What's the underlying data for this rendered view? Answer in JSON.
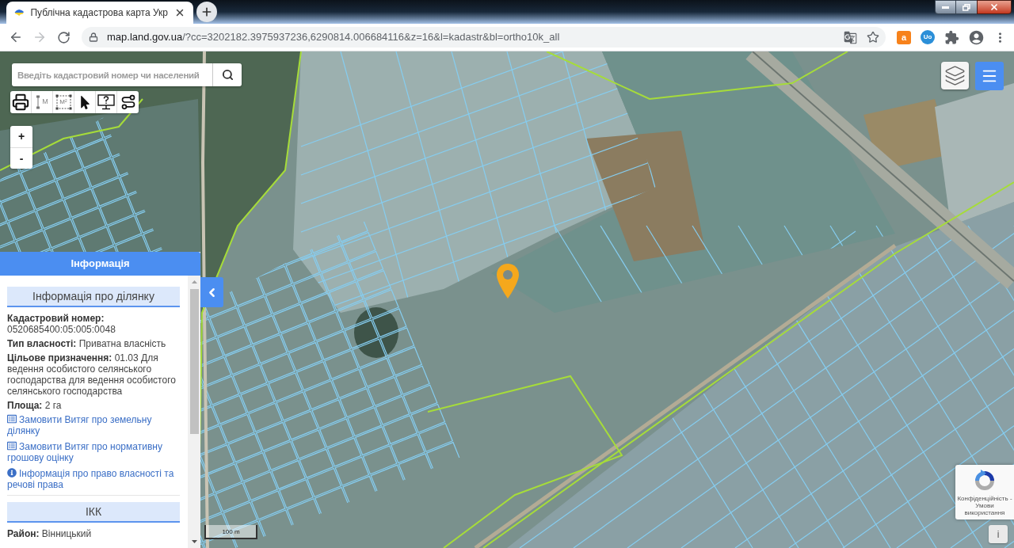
{
  "browser": {
    "tabs": [
      {
        "title": "Публічна кадастрова карта Укр",
        "selected": true
      }
    ],
    "forward_button": {
      "disabled": true
    },
    "address": {
      "host": "map.land.gov.ua",
      "path": "/?cc=3202182.3975937236,6290814.006684116&z=16&l=kadastr&bl=ortho10k_all"
    },
    "extensions": [
      {
        "kind": "bag",
        "label": "a"
      },
      {
        "kind": "circle",
        "label": "Uo"
      }
    ]
  },
  "map": {
    "search": {
      "placeholder": "Введіть кадастровий номер чи населений"
    },
    "tools": [
      {
        "kind": "print"
      },
      {
        "kind": "distance",
        "label": "M"
      },
      {
        "kind": "area",
        "label": "M²"
      },
      {
        "kind": "select"
      },
      {
        "kind": "help"
      },
      {
        "kind": "route"
      }
    ],
    "zoom_buttons": [
      "+",
      "-"
    ],
    "scale": "100 m",
    "recaptcha": "Конфіденційність - Умови використання",
    "info_button": "i"
  },
  "info_panel": {
    "title": "Інформація",
    "sections": [
      {
        "heading": "Інформація про ділянку",
        "fields": [
          {
            "label": "Кадастровий номер:",
            "value": "0520685400:05:005:0048"
          },
          {
            "label": "Тип власності:",
            "value": "Приватна власність"
          },
          {
            "label": "Цільове призначення:",
            "value": "01.03 Для ведення особистого селянського господарства для ведення особистого селянського господарства"
          },
          {
            "label": "Площа:",
            "value": "2 га"
          }
        ],
        "links": [
          {
            "kind": "document",
            "text": "Замовити Витяг про земельну ділянку"
          },
          {
            "kind": "document",
            "text": "Замовити Витяг про нормативну грошову оцінку"
          },
          {
            "kind": "info",
            "text": "Інформація про право власності та речові права"
          }
        ]
      },
      {
        "heading": "ІКК",
        "fields": [
          {
            "label": "Район:",
            "value": "Вінницький"
          }
        ]
      }
    ]
  }
}
